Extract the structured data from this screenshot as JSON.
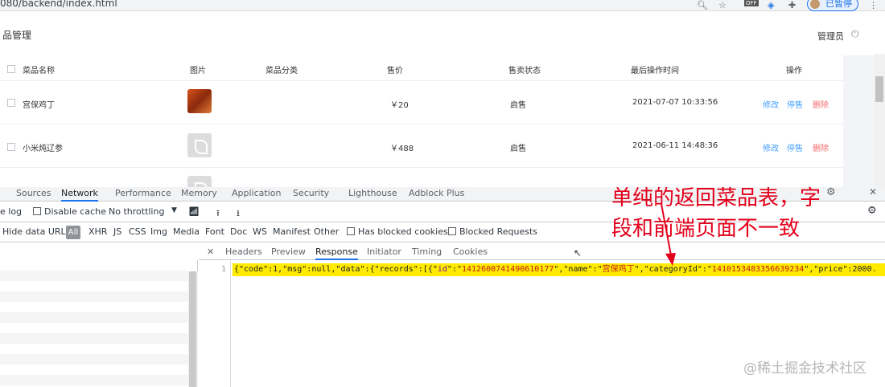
{
  "browser": {
    "url": "080/backend/index.html",
    "pause_label": "已暂停",
    "menu_icon": "more-vert-icon"
  },
  "app": {
    "title": "品管理",
    "admin_label": "管理员"
  },
  "table": {
    "headers": [
      "菜品名称",
      "图片",
      "菜品分类",
      "售价",
      "售卖状态",
      "最后操作时间",
      "操作"
    ],
    "rows": [
      {
        "name": "宫保鸡丁",
        "category": "",
        "price": "￥20",
        "status": "启售",
        "time": "2021-07-07 10:33:56"
      },
      {
        "name": "小米炖辽参",
        "category": "",
        "price": "￥488",
        "status": "启售",
        "time": "2021-06-11 14:48:36"
      }
    ],
    "actions": {
      "edit": "修改",
      "stop": "停售",
      "delete": "删除"
    }
  },
  "devtools": {
    "tabs": [
      "Sources",
      "Network",
      "Performance",
      "Memory",
      "Application",
      "Security",
      "Lighthouse",
      "Adblock Plus"
    ],
    "active_tab": "Network",
    "toolbar": {
      "preserve_log": "e log",
      "disable_cache": "Disable cache",
      "throttling": "No throttling"
    },
    "filter": {
      "hide_data_urls": "Hide data URLs",
      "all": "All",
      "types": [
        "XHR",
        "JS",
        "CSS",
        "Img",
        "Media",
        "Font",
        "Doc",
        "WS",
        "Manifest",
        "Other"
      ],
      "has_blocked_cookies": "Has blocked cookies",
      "blocked_requests": "Blocked Requests"
    },
    "detail_tabs": [
      "Headers",
      "Preview",
      "Response",
      "Initiator",
      "Timing",
      "Cookies"
    ],
    "active_detail_tab": "Response",
    "response": {
      "line_number": "1",
      "parts": [
        {
          "t": "{\"code\":1,\"msg\":null,\"data\":{\"records\":[{\"",
          "c": "p"
        },
        {
          "t": "id",
          "c": "k"
        },
        {
          "t": "\":\"",
          "c": "p"
        },
        {
          "t": "1412600741490610177",
          "c": "s"
        },
        {
          "t": "\",\"name\":\"",
          "c": "p"
        },
        {
          "t": "宫保鸡丁",
          "c": "s"
        },
        {
          "t": "\",\"categoryId\":\"",
          "c": "p"
        },
        {
          "t": "1410153483356639234",
          "c": "s"
        },
        {
          "t": "\",\"price\":2000.",
          "c": "p"
        }
      ]
    }
  },
  "annotation": {
    "line1": "单纯的返回菜品表，字",
    "line2": "段和前端页面不一致",
    "color": "#e3001b"
  },
  "watermark": "@稀土掘金技术社区"
}
